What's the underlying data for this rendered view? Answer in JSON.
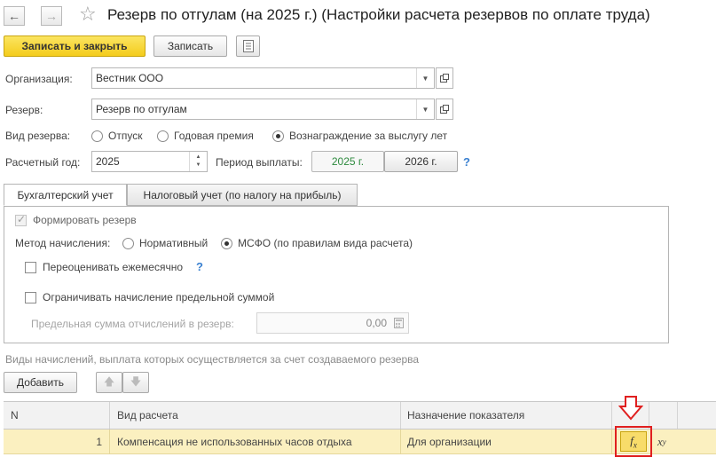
{
  "window": {
    "title": "Резерв по отгулам (на 2025 г.) (Настройки расчета резервов по оплате труда)"
  },
  "toolbar": {
    "save_close_label": "Записать и закрыть",
    "save_label": "Записать"
  },
  "form": {
    "organization_label": "Организация:",
    "organization_value": "Вестник ООО",
    "reserve_label": "Резерв:",
    "reserve_value": "Резерв по отгулам",
    "reserve_type_label": "Вид резерва:",
    "reserve_type_options": [
      "Отпуск",
      "Годовая премия",
      "Вознаграждение за выслугу лет"
    ],
    "reserve_type_selected": "Вознаграждение за выслугу лет",
    "year_label": "Расчетный год:",
    "year_value": "2025",
    "payment_period_label": "Период выплаты:",
    "payment_period_options": [
      "2025 г.",
      "2026 г."
    ],
    "payment_period_selected": "2025 г."
  },
  "tabs": [
    {
      "label": "Бухгалтерский учет",
      "active": true
    },
    {
      "label": "Налоговый учет (по налогу на прибыль)",
      "active": false
    }
  ],
  "accounting": {
    "form_reserve_label": "Формировать резерв",
    "form_reserve_checked": true,
    "method_label": "Метод начисления:",
    "method_options": [
      "Нормативный",
      "МСФО (по правилам вида расчета)"
    ],
    "method_selected": "МСФО (по правилам вида расчета)",
    "revalue_label": "Переоценивать ежемесячно",
    "revalue_checked": false,
    "limit_label": "Ограничивать начисление предельной суммой",
    "limit_checked": false,
    "limit_sum_label": "Предельная сумма отчислений в резерв:",
    "limit_sum_value": "0,00"
  },
  "accruals": {
    "caption": "Виды начислений, выплата которых осуществляется за счет создаваемого резерва",
    "add_label": "Добавить",
    "columns": [
      "N",
      "Вид расчета",
      "Назначение показателя"
    ],
    "rows": [
      {
        "n": "1",
        "type": "Компенсация не использованных часов отдыха",
        "purpose": "Для организации"
      }
    ],
    "fx_label": "fx",
    "xy_label": "xy"
  },
  "colors": {
    "primary_button": "#f4cc1c",
    "selected_row": "#fbf0c0",
    "highlight_frame": "#e02020",
    "help": "#3a80d0",
    "period_selected_text": "#2d8a3e"
  }
}
